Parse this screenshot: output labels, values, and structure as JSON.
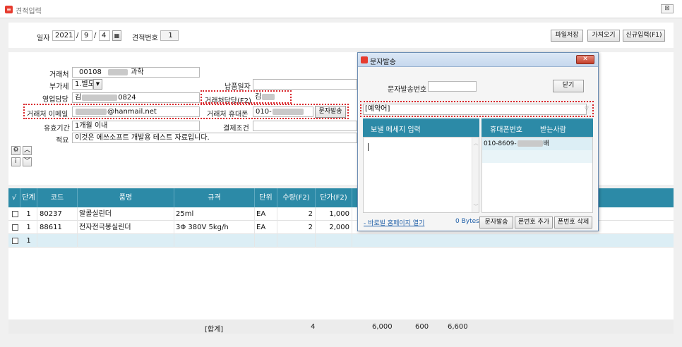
{
  "window": {
    "title": "견적입력",
    "close": "⊠"
  },
  "header": {
    "date_label": "일자",
    "year": "2021",
    "month": "9",
    "day": "4",
    "date_sep": "/",
    "quote_no_label": "견적번호",
    "quote_no": "1",
    "buttons": [
      "파일저장",
      "가져오기",
      "신규입력(F1)"
    ]
  },
  "form": {
    "client_label": "거래처",
    "client_code": "00108",
    "client_name_suffix": "과학",
    "vat_label": "부가세",
    "vat_value": "1.별도",
    "delivery_label": "납품일자",
    "sales_rep_label": "영업담당",
    "sales_rep_prefix": "김",
    "sales_rep_suffix": "0824",
    "client_contact_label": "거래처담당(F2)",
    "client_contact_value": "김",
    "email_label": "거래처 이메일",
    "email_suffix": "@hanmail.net",
    "phone_label": "거래처 휴대폰",
    "phone_value": "010-",
    "sms_button": "문자발송",
    "validity_label": "유효기간",
    "validity_value": "1개월 이내",
    "payment_label": "결제조건",
    "memo_label": "적요",
    "memo_value": "이것은 에쓰소프트 개발용 테스트 자료입니다."
  },
  "grid": {
    "headers": [
      "√",
      "단계",
      "코드",
      "품명",
      "규격",
      "단위",
      "수량(F2)",
      "단가(F2)"
    ],
    "rows": [
      {
        "step": "1",
        "code": "80237",
        "name": "알콜실린더",
        "spec": "25ml",
        "unit": "EA",
        "qty": "2",
        "price": "1,000"
      },
      {
        "step": "1",
        "code": "88611",
        "name": "전자전극봉실린더",
        "spec": "3Φ 380V 5kg/h",
        "unit": "EA",
        "qty": "2",
        "price": "2,000"
      },
      {
        "step": "1",
        "code": "",
        "name": "",
        "spec": "",
        "unit": "",
        "qty": "",
        "price": ""
      }
    ],
    "total": {
      "label": "[합계]",
      "qty": "4",
      "amount": "6,000",
      "vat": "600",
      "sum": "6,600"
    }
  },
  "dialog": {
    "title": "문자발송",
    "sms_no_label": "문자발송번호",
    "close_button": "닫기",
    "reserved_select": "[예약어]",
    "message_header": "보낼 메세지 입력",
    "phone_col": "휴대폰번호",
    "recipient_col": "받는사람",
    "recipient_phone": "010-8609-",
    "recipient_suffix": "배",
    "homepage_link": "- 바로빌 홈페이지 열기",
    "bytes": "0 Bytes",
    "buttons": [
      "문자발송",
      "폰번호 추가",
      "폰번호 삭제"
    ]
  },
  "colors": {
    "accent": "#2c8aa7",
    "highlight": "#d9262b"
  }
}
